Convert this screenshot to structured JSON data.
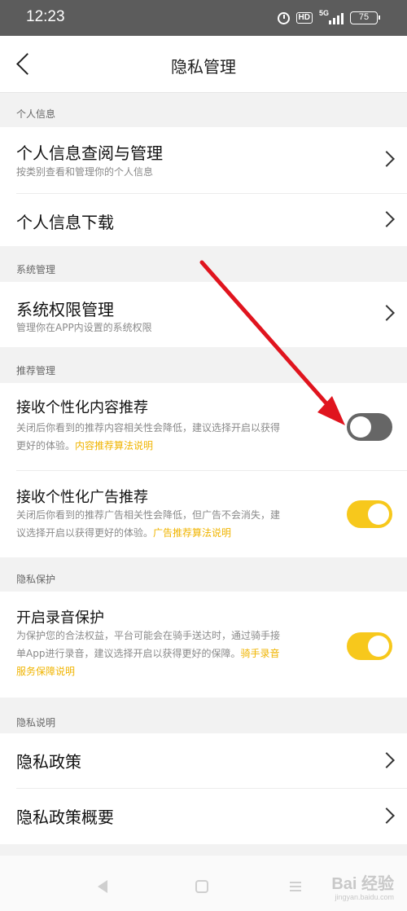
{
  "status_bar": {
    "time": "12:23",
    "hd": "HD",
    "network": "5G",
    "battery": "75"
  },
  "nav": {
    "title": "隐私管理"
  },
  "sections": {
    "personal_info": "个人信息",
    "system_mgmt": "系统管理",
    "recommend_mgmt": "推荐管理",
    "privacy_protect": "隐私保护",
    "privacy_desc": "隐私说明"
  },
  "rows": {
    "personal_view": {
      "title": "个人信息查阅与管理",
      "sub": "按类别查看和管理你的个人信息"
    },
    "personal_download": {
      "title": "个人信息下载"
    },
    "system_perm": {
      "title": "系统权限管理",
      "sub": "管理你在APP内设置的系统权限"
    },
    "content_recommend": {
      "title": "接收个性化内容推荐",
      "sub_line1": "关闭后你看到的推荐内容相关性会降低，建议选择开启以获得",
      "sub_line2": "更好的体验。",
      "link": "内容推荐算法说明",
      "enabled": false
    },
    "ad_recommend": {
      "title": "接收个性化广告推荐",
      "sub_line1": "关闭后你看到的推荐广告相关性会降低，但广告不会消失，建",
      "sub_line2": "议选择开启以获得更好的体验。",
      "link": "广告推荐算法说明",
      "enabled": true
    },
    "recording": {
      "title": "开启录音保护",
      "sub_line1": "为保护您的合法权益，平台可能会在骑手送达时，通过骑手接",
      "sub_line2": "单App进行录音，建议选择开启以获得更好的保障。",
      "link_part1": "骑手录音",
      "link_part2": "服务保障说明",
      "enabled": true
    },
    "privacy_policy": {
      "title": "隐私政策"
    },
    "privacy_summary": {
      "title": "隐私政策概要"
    }
  },
  "watermark": {
    "brand": "Bai 经验",
    "url": "jingyan.baidu.com"
  },
  "colors": {
    "accent": "#f7c81c",
    "link": "#f0b400",
    "annotation_arrow": "#e0141e"
  }
}
